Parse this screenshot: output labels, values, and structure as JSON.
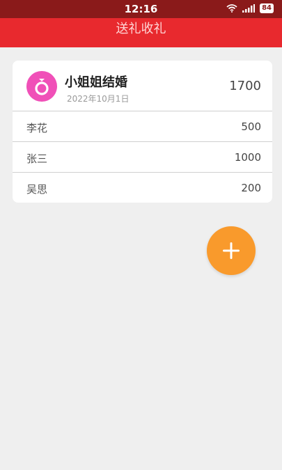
{
  "status_bar": {
    "time": "12:16",
    "battery": "84"
  },
  "header": {
    "title": "送礼收礼"
  },
  "event": {
    "name": "小姐姐结婚",
    "date": "2022年10月1日",
    "total": "1700"
  },
  "gifts": [
    {
      "name": "李花",
      "amount": "500"
    },
    {
      "name": "张三",
      "amount": "1000"
    },
    {
      "name": "吴思",
      "amount": "200"
    }
  ],
  "icons": {
    "event_avatar": "ring-icon",
    "fab": "plus-icon",
    "wifi": "wifi-icon",
    "signal": "signal-icon",
    "battery": "battery-icon"
  },
  "colors": {
    "status_bar": "#8a1a1a",
    "title_bar": "#e8292e",
    "avatar": "#f050b8",
    "fab": "#f99a2c"
  }
}
